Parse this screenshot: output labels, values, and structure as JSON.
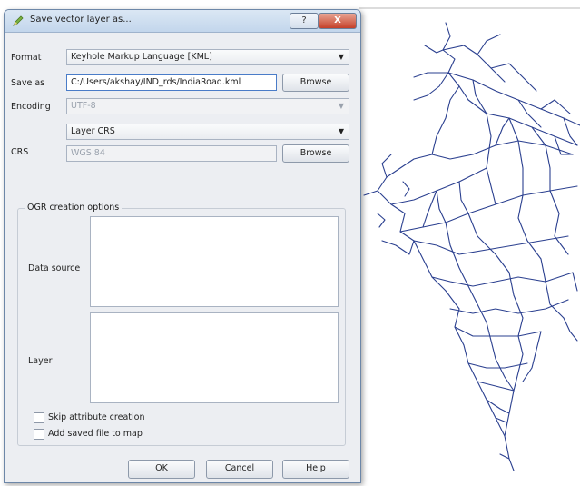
{
  "dialog": {
    "title": "Save vector layer as...",
    "help_glyph": "?",
    "close_glyph": "X",
    "format_label": "Format",
    "format_value": "Keyhole Markup Language [KML]",
    "saveas_label": "Save as",
    "saveas_value": "C:/Users/akshay/IND_rds/IndiaRoad.kml",
    "browse_label": "Browse",
    "encoding_label": "Encoding",
    "encoding_value": "UTF-8",
    "crs_label": "CRS",
    "crs_mode": "Layer CRS",
    "crs_value": "WGS 84",
    "ogr_group": "OGR creation options",
    "datasource_label": "Data source",
    "layer_label": "Layer",
    "skip_attr_label": "Skip attribute creation",
    "add_map_label": "Add saved file to map",
    "ok_label": "OK",
    "cancel_label": "Cancel",
    "help_label": "Help"
  },
  "colors": {
    "road_line": "#2a3f8f",
    "title_gradient_top": "#dbe7f4",
    "close_button": "#c5412a"
  },
  "icons": {
    "title_icon": "qgis-pencil-icon",
    "dropdown": "chevron-down-icon"
  }
}
